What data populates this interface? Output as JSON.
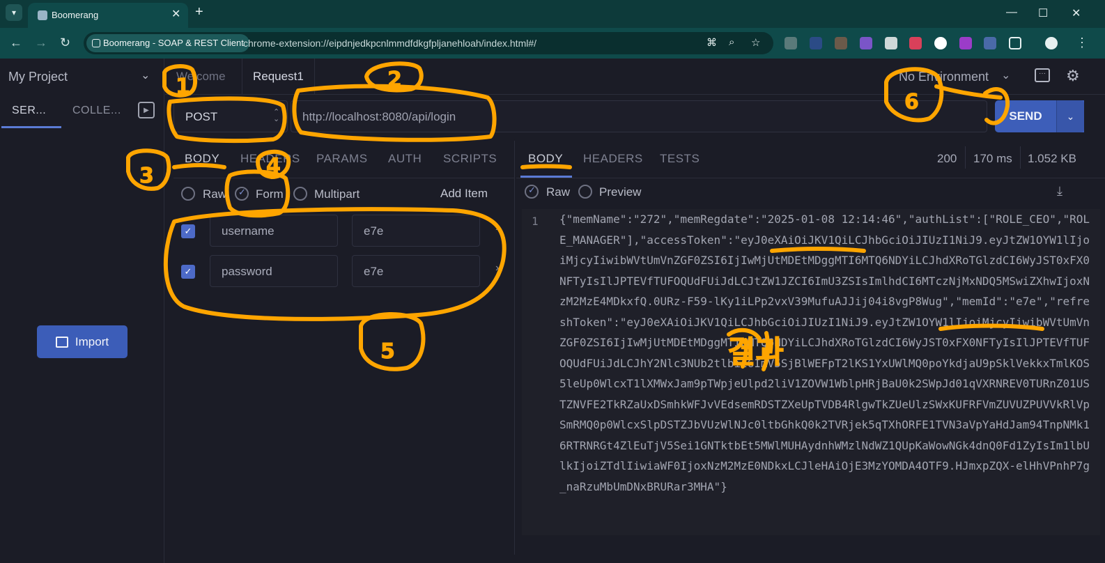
{
  "browser": {
    "tab_title": "Boomerang",
    "site_chip": "Boomerang - SOAP & REST Client",
    "url": "chrome-extension://eipdnjedkpcnlmmdfdkgfpljanehloah/index.html#/"
  },
  "sidebar": {
    "project": "My Project",
    "tabs": [
      "SER...",
      "COLLE..."
    ],
    "import_label": "Import"
  },
  "request_tabs": {
    "welcome": "Welcome",
    "current": "Request1"
  },
  "environment": "No Environment",
  "request": {
    "method": "POST",
    "url": "http://localhost:8080/api/login",
    "send_label": "SEND"
  },
  "request_panel": {
    "tabs": [
      "BODY",
      "HEADERS",
      "PARAMS",
      "AUTH",
      "SCRIPTS"
    ],
    "body_modes": [
      "Raw",
      "Form",
      "Multipart"
    ],
    "selected_mode": "Form",
    "add_item": "Add Item",
    "fields": [
      {
        "key": "username",
        "value": "e7e",
        "checked": true
      },
      {
        "key": "password",
        "value": "e7e",
        "checked": true
      }
    ]
  },
  "response_panel": {
    "tabs": [
      "BODY",
      "HEADERS",
      "TESTS"
    ],
    "status": "200",
    "time": "170 ms",
    "size": "1.052 KB",
    "view_modes": [
      "Raw",
      "Preview"
    ],
    "line_number": "1",
    "body": "{\"memName\":\"272\",\"memRegdate\":\"2025-01-08 12:14:46\",\"authList\":[\"ROLE_CEO\",\"ROLE_MANAGER\"],\"accessToken\":\"eyJ0eXAiOiJKV1QiLCJhbGciOiJIUzI1NiJ9.eyJtZW1OYW1lIjoiMjcyIiwibWVtUmVnZGF0ZSI6IjIwMjUtMDEtMDggMTI6MTQ6NDYiLCJhdXRoTGlzdCI6WyJST0xFX0NFTyIsIlJPTEVfTUFOQUdFUiJdLCJtZW1JZCI6ImU3ZSIsImlhdCI6MTczNjMxNDQ5MSwiZXhwIjoxNzM2MzE4MDkxfQ.0URz-F59-lKy1iLPp2vxV39MufuAJJij04i8vgP8Wug\",\"memId\":\"e7e\",\"refreshToken\":\"eyJ0eXAiOiJKV1QiLCJhbGciOiJIUzI1NiJ9.eyJtZW1OYW1lIjoiMjcyIiwibWVtUmVnZGF0ZSI6IjIwMjUtMDEtMDggMTI6MTQ6NDYiLCJhdXRoTGlzdCI6WyJST0xFX0NFTyIsIlJPTEVfTUFOQUdFUiJdLCJhY2Nlc3NUb2tlbiI6ImV5SjBlWEFpT2lKS1YxUWlMQ0poYkdjaU9pSklVekkxTmlKOS5leUp0WlcxT1lXMWxJam9pTWpjeUlpd2liV1ZOVW1WblpHRjBaU0k2SWpJd01qVXRNREV0TURnZ01USTZNVFE2TkRZaUxDSmhkWFJvVEdsemRDSTZXeUpTVDB4RlgwTkZUeUlzSWxKUFRFVmZUVUZPUVVkRlVpSmRMQ0p0WlcxSlpDSTZJbVUzWlNJc0ltbGhkQ0k2TVRjek5qTXhORFE1TVN3aVpYaHdJam94TnpNMk16RTRNRGt4ZlEuTjV5Sei1GNTktbEt5MWlMUHAydnhWMzlNdWZ1QUpKaWowNGk4dnQ0Fd1ZyIsIm1lbUlkIjoiZTdlIiwiaWF0IjoxNzM2MzE0NDkxLCJleHAiOjE3MzYOMDA4OTF9.HJmxpZQX-elHhVPnhP7g_naRzuMbUmDNxBRURar3MHA\"}"
  },
  "annotations": {
    "labels": [
      "1",
      "2",
      "3",
      "4",
      "5",
      "6"
    ],
    "result_label": "결과",
    "color": "#ffa500"
  }
}
